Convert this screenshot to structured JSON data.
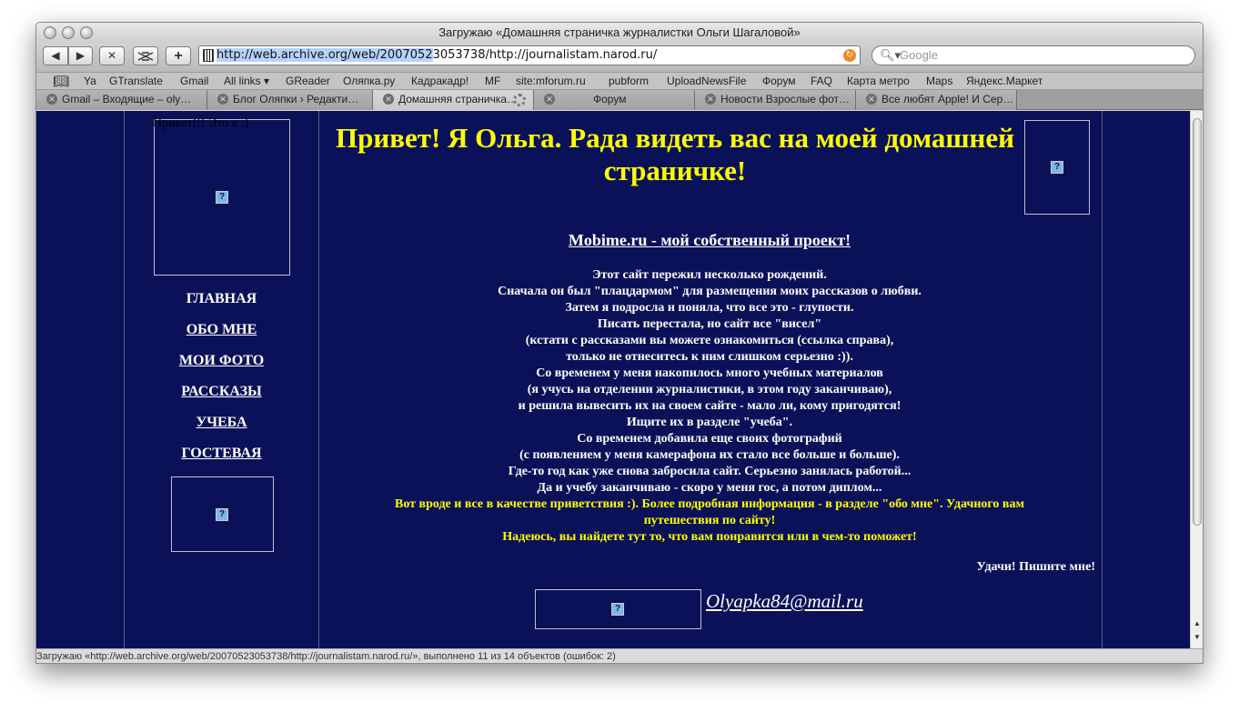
{
  "window": {
    "title": "Загружаю «Домашняя страничка журналистки Ольги Шагаловой»"
  },
  "toolbar": {
    "back_label": "◀",
    "forward_label": "▶",
    "stop_label": "✕",
    "add_label": "+",
    "url_selected": "http://web.archive.org/web/2007052",
    "url_rest": "3053738/http://journalistam.narod.ru/",
    "search_placeholder": "Google"
  },
  "bookmarks": [
    "Ya",
    "GTranslate",
    "Gmail",
    "All links ▾",
    "GReader",
    "Оляпка.ру",
    "Кадракадр!",
    "MF",
    "site:mforum.ru",
    "pubform",
    "UploadNewsFile",
    "Форум",
    "FAQ",
    "Карта метро",
    "Maps",
    "Яндекс.Маркет"
  ],
  "tabs": [
    "Gmail – Входящие – oly…",
    "Блог Оляпки › Редакти…",
    "Домашняя страничка…",
    "Форум",
    "Новости Взрослые фот…",
    "Все любят Apple! И Сер…"
  ],
  "page": {
    "hello": "Привет!!! Это я :)",
    "nav": [
      "ГЛАВНАЯ",
      "ОБО МНЕ",
      "МОИ ФОТО",
      "РАССКАЗЫ",
      "УЧЕБА",
      "ГОСТЕВАЯ"
    ],
    "headline": "Привет! Я Ольга. Рада видеть вас на моей домашней страничке!",
    "subhead": "Mobime.ru - мой собственный проект!",
    "body": [
      "Этот сайт пережил несколько рождений.",
      "Сначала он был \"плацдармом\" для размещения моих рассказов о любви.",
      "Затем я подросла и поняла, что все это - глупости.",
      "Писать перестала, но сайт все \"висел\"",
      "(кстати с рассказами вы можете ознакомиться (ссылка справа),",
      "только не отнеситесь к ним слишком серьезно :)).",
      "Со временем у меня накопилось много учебных материалов",
      "(я учусь на отделении журналистики, в этом году заканчиваю),",
      "и решила вывесить их на своем сайте - мало ли, кому пригодятся!",
      "Ищите их в разделе \"учеба\".",
      "Со временем добавила еще своих фотографий",
      "(с появлением у меня камерафона их стало все больше и больше).",
      "Где-то год как уже снова забросила сайт. Серьезно занялась работой...",
      "Да и учебу заканчиваю - скоро у меня гос, а потом диплом..."
    ],
    "yellow": [
      "Вот вроде и все в качестве приветствия :). Более подробная информация - в разделе \"обо мне\". Удачного вам",
      "путешествия по сайту!",
      "Надеюсь, вы найдете тут то, что вам понравится или в чем-то поможет!"
    ],
    "signoff": "Удачи! Пишите мне!",
    "email": "Olyapka84@mail.ru",
    "broken_image_glyph": "?"
  },
  "status": "Загружаю «http://web.archive.org/web/20070523053738/http://journalistam.narod.ru/», выполнено 11 из 14 объектов (ошибок: 2)",
  "colors": {
    "page_bg": "#0a1158",
    "heading": "#ffff00",
    "text": "#ffffff"
  }
}
